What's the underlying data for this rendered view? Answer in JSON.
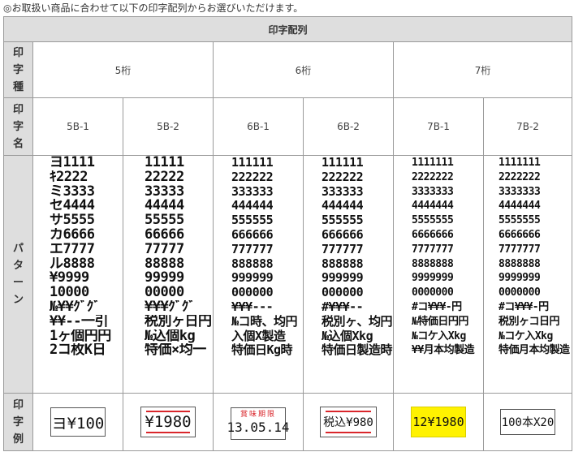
{
  "note": "◎お取扱い商品に合わせて以下の印字配列からお選びいただけます。",
  "title": "印字配列",
  "side": {
    "type": [
      "印",
      "字",
      "種"
    ],
    "name": [
      "印",
      "字",
      "名"
    ],
    "pattern": [
      "パ",
      "タ",
      "ー",
      "ン"
    ],
    "example": [
      "印",
      "字",
      "例"
    ]
  },
  "digits": [
    "5桁",
    "6桁",
    "7桁"
  ],
  "columns": [
    {
      "name": "5B-1",
      "lines": [
        "ヨ1111",
        "ｷ2222",
        "ミ3333",
        "セ4444",
        "サ5555",
        "カ6666",
        "エ7777",
        "ル8888",
        "¥9999",
        "10000",
        "№¥¥ｸﾞｸﾞ",
        "¥¥--一引",
        "1ヶ個円円",
        "2コ枚K日"
      ],
      "example": "ヨ¥100"
    },
    {
      "name": "5B-2",
      "lines": [
        "11111",
        "22222",
        "33333",
        "44444",
        "55555",
        "66666",
        "77777",
        "88888",
        "99999",
        "00000",
        "¥¥¥ｸﾞｸﾞ",
        "税別ヶ日円",
        "№込個kg",
        "特価×均一"
      ],
      "example": "¥1980"
    },
    {
      "name": "6B-1",
      "lines": [
        "111111",
        "222222",
        "333333",
        "444444",
        "555555",
        "666666",
        "777777",
        "888888",
        "999999",
        "000000",
        "¥¥¥---",
        "№コ時、均円",
        "入個X製造",
        "特価日Kg時"
      ],
      "example_top": "賞味期限",
      "example": "13.05.14"
    },
    {
      "name": "6B-2",
      "lines": [
        "111111",
        "222222",
        "333333",
        "444444",
        "555555",
        "666666",
        "777777",
        "888888",
        "999999",
        "000000",
        "#¥¥¥--",
        "税別ヶ、均円",
        "№込個Xkg",
        "特価日製造時"
      ],
      "example": "税込¥980"
    },
    {
      "name": "7B-1",
      "lines": [
        "1111111",
        "2222222",
        "3333333",
        "4444444",
        "5555555",
        "6666666",
        "7777777",
        "8888888",
        "9999999",
        "0000000",
        "#コ¥¥¥-円",
        "№特価日円円",
        "№コケ入Xkg",
        "¥¥月本均製造"
      ],
      "example": "12¥1980"
    },
    {
      "name": "7B-2",
      "lines": [
        "1111111",
        "2222222",
        "3333333",
        "4444444",
        "5555555",
        "6666666",
        "7777777",
        "8888888",
        "9999999",
        "0000000",
        "#コ¥¥¥-円",
        "税別ヶコ日円",
        "№コケ入Xkg",
        "特価月本均製造"
      ],
      "example": "100本X20"
    }
  ],
  "colors": {
    "header_bg": "#dedede",
    "border": "#9a9a9a",
    "accent_red": "#d9262b",
    "highlight_yellow": "#fff200"
  }
}
